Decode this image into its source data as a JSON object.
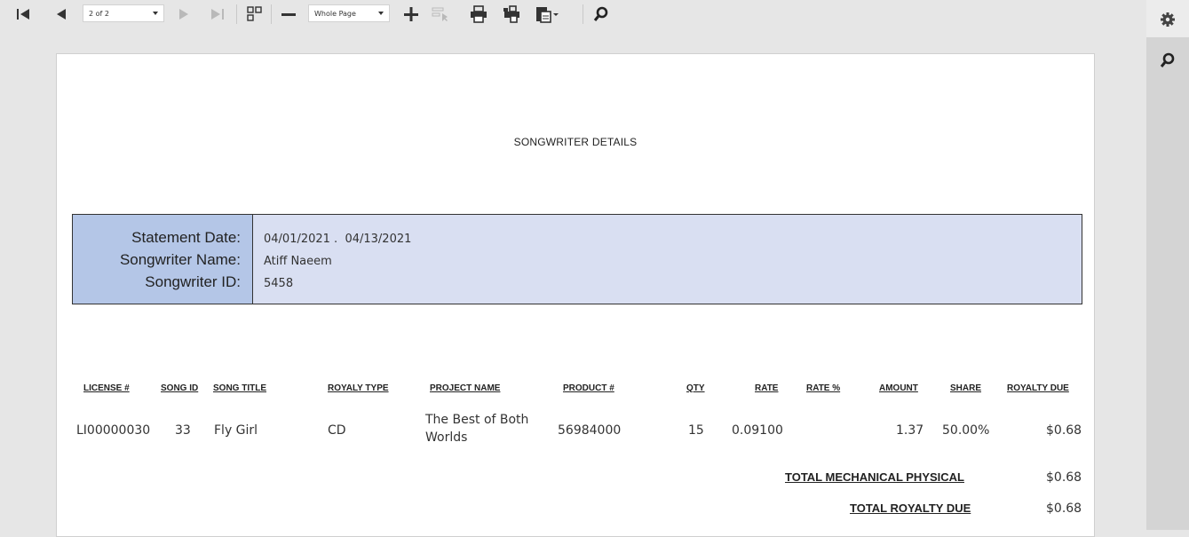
{
  "toolbar": {
    "page_select": "2 of 2",
    "zoom_select": "Whole Page"
  },
  "report": {
    "title": "SONGWRITER DETAILS",
    "info_labels": [
      "Statement Date:",
      "Songwriter Name:",
      "Songwriter ID:"
    ],
    "statement_date": "04/01/2021 .  04/13/2021",
    "songwriter_name": "Atiff Naeem",
    "songwriter_id": "5458"
  },
  "table": {
    "headers": [
      "LICENSE #",
      "SONG ID",
      "SONG TITLE",
      "ROYALY TYPE",
      "PROJECT NAME",
      "PRODUCT #",
      "QTY",
      "RATE",
      "RATE %",
      "AMOUNT",
      "SHARE",
      "ROYALTY DUE"
    ],
    "rows": [
      {
        "license": "LI00000030",
        "song_id": "33",
        "song_title": "Fly Girl",
        "royalty_type": "CD",
        "project_name_line1": "The Best of Both",
        "project_name_line2": "Worlds",
        "product": "56984000",
        "qty": "15",
        "rate": "0.09100",
        "rate_pct": "",
        "amount": "1.37",
        "share": "50.00%",
        "royalty_due": "$0.68"
      }
    ]
  },
  "totals": {
    "mechanical_label": "TOTAL MECHANICAL PHYSICAL",
    "mechanical_value": "$0.68",
    "royalty_label": "TOTAL ROYALTY DUE",
    "royalty_value": "$0.68"
  }
}
